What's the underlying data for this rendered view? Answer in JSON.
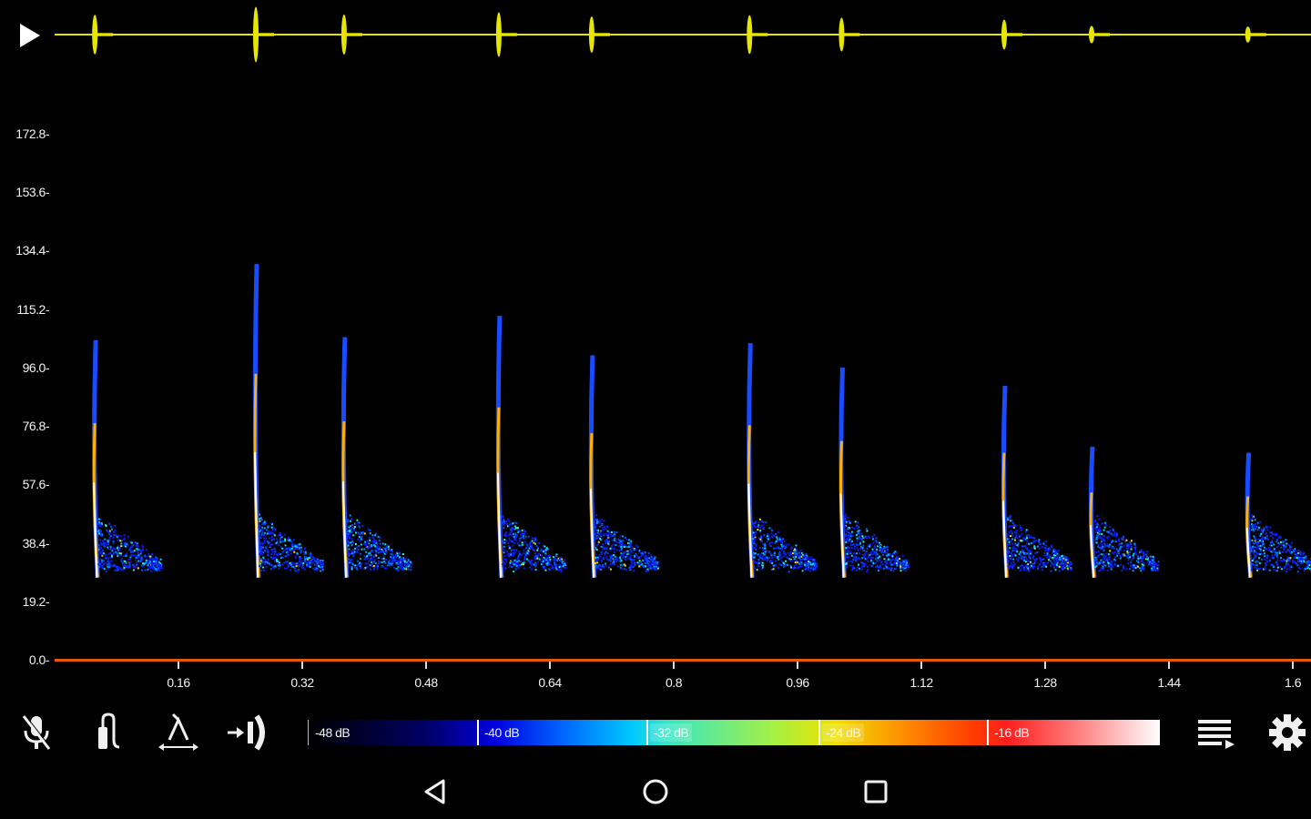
{
  "waveform": {
    "color": "#e6e600",
    "play_icon": "play-icon"
  },
  "spectrogram": {
    "freq_labels": [
      "172.8",
      "153.6",
      "134.4",
      "115.2",
      "96.0",
      "76.8",
      "57.6",
      "38.4",
      "19.2",
      "0.0"
    ],
    "freq_values": [
      172.8,
      153.6,
      134.4,
      115.2,
      96.0,
      76.8,
      57.6,
      38.4,
      19.2,
      0.0
    ],
    "freq_max": 192.0,
    "time_labels": [
      "0.16",
      "0.32",
      "0.48",
      "0.64",
      "0.8",
      "0.96",
      "1.12",
      "1.28",
      "1.44",
      "1.6"
    ],
    "time_values": [
      0.16,
      0.32,
      0.48,
      0.64,
      0.8,
      0.96,
      1.12,
      1.28,
      1.44,
      1.6
    ],
    "time_max": 1.6,
    "calls": [
      {
        "t": 0.052,
        "fmax": 105
      },
      {
        "t": 0.26,
        "fmax": 130
      },
      {
        "t": 0.374,
        "fmax": 106
      },
      {
        "t": 0.574,
        "fmax": 113
      },
      {
        "t": 0.694,
        "fmax": 100
      },
      {
        "t": 0.898,
        "fmax": 104
      },
      {
        "t": 1.017,
        "fmax": 96
      },
      {
        "t": 1.227,
        "fmax": 90
      },
      {
        "t": 1.34,
        "fmax": 70
      },
      {
        "t": 1.542,
        "fmax": 68
      }
    ],
    "axis_color": "#e8550a"
  },
  "toolbar": {
    "mic_icon": "mic-off-icon",
    "stylus_icon": "stylus-icon",
    "lambda_icon": "lambda-measure-icon",
    "zoom_icon": "zoom-fit-icon",
    "list_icon": "playlist-icon",
    "settings_icon": "gear-icon",
    "colorbar_labels": [
      "-48 dB",
      "-40 dB",
      "-32 dB",
      "-24 dB",
      "-16 dB"
    ]
  },
  "navbar": {
    "back_icon": "back-triangle-icon",
    "home_icon": "home-circle-icon",
    "recents_icon": "recents-square-icon"
  }
}
